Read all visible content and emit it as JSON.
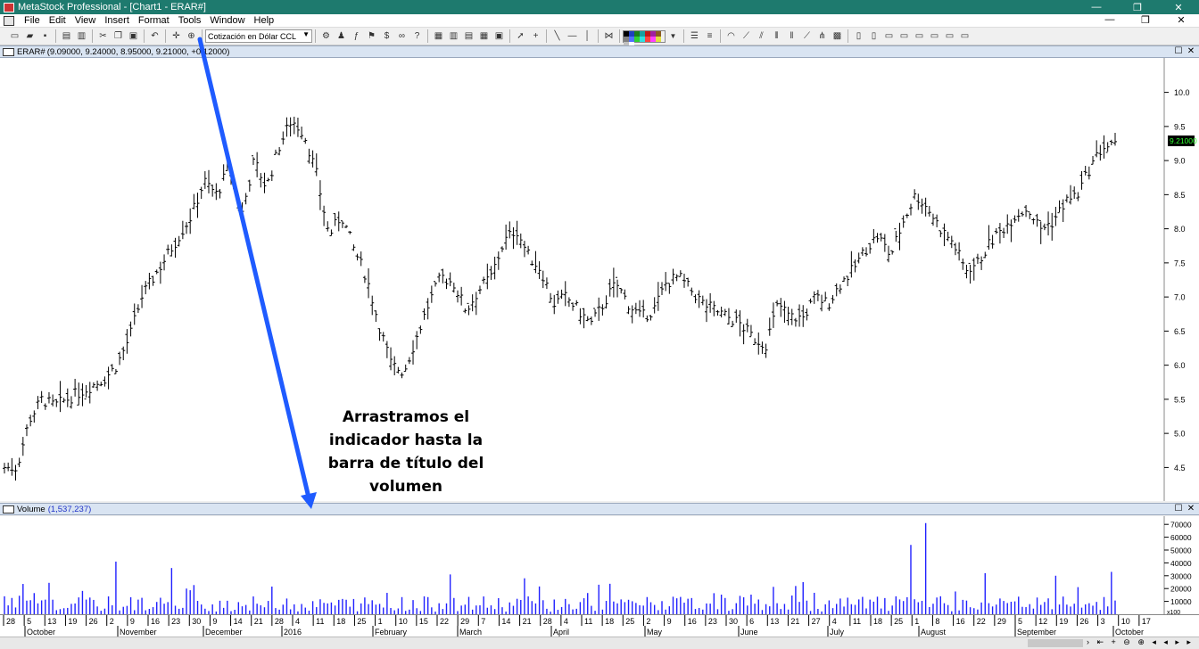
{
  "window": {
    "title": "MetaStock Professional - [Chart1 - ERAR#]",
    "buttons": {
      "minimize": "—",
      "restore": "❐",
      "close": "✕"
    }
  },
  "menu": [
    "File",
    "Edit",
    "View",
    "Insert",
    "Format",
    "Tools",
    "Window",
    "Help"
  ],
  "mdi_buttons": {
    "minimize": "—",
    "restore": "❐",
    "close": "✕"
  },
  "toolbar": {
    "indicator_combo": "Cotización en Dólar CCL",
    "palette": [
      "#000000",
      "#1f3fbf",
      "#1b7f1b",
      "#18a0a0",
      "#c01818",
      "#a020a0",
      "#8a5a20",
      "#808080",
      "#5070ff",
      "#30d030",
      "#30e0e0",
      "#ff4040",
      "#ff40ff",
      "#e0e040",
      "#c0c0c0",
      "#ffffff"
    ]
  },
  "price_pane": {
    "title": "ERAR#",
    "info": "(9.09000, 9.24000, 8.95000, 9.21000, +0.12000)",
    "last_value": "9.21000"
  },
  "volume_pane": {
    "title": "Volume",
    "info": "(1,537,237)",
    "scale_note": "x100"
  },
  "annotation": {
    "lines": [
      "Arrastramos el",
      "indicador hasta la",
      "barra de título del",
      "volumen"
    ],
    "arrow_color": "#1f5bff"
  },
  "chart_data": {
    "type": "bar",
    "price_axis": {
      "ylim": [
        4.1,
        10.4
      ],
      "ticks": [
        "4.5",
        "5.0",
        "5.5",
        "6.0",
        "6.5",
        "7.0",
        "7.5",
        "8.0",
        "8.5",
        "9.0",
        "9.5",
        "10.0"
      ]
    },
    "volume_axis": {
      "ylim": [
        0,
        75000
      ],
      "ticks": [
        "10000",
        "20000",
        "30000",
        "40000",
        "50000",
        "60000",
        "70000"
      ]
    },
    "x_day_labels": [
      "28",
      "5",
      "13",
      "19",
      "26",
      "2",
      "9",
      "16",
      "23",
      "30",
      "9",
      "14",
      "21",
      "28",
      "4",
      "11",
      "18",
      "25",
      "1",
      "10",
      "15",
      "22",
      "29",
      "7",
      "14",
      "21",
      "28",
      "4",
      "11",
      "18",
      "25",
      "2",
      "9",
      "16",
      "23",
      "30",
      "6",
      "13",
      "21",
      "27",
      "4",
      "11",
      "18",
      "25",
      "1",
      "8",
      "16",
      "22",
      "29",
      "5",
      "12",
      "19",
      "26",
      "3",
      "10",
      "17"
    ],
    "x_month_labels": [
      "October",
      "November",
      "December",
      "2016",
      "February",
      "March",
      "April",
      "May",
      "June",
      "July",
      "August",
      "September",
      "October"
    ],
    "close_path": [
      [
        4.5,
        4.5
      ],
      [
        5.2,
        5.5
      ],
      [
        5.4,
        5.5
      ],
      [
        5.6,
        5.7
      ],
      [
        5.8,
        6.0
      ],
      [
        6.4,
        7.0
      ],
      [
        7.3,
        7.6
      ],
      [
        7.9,
        8.2
      ],
      [
        8.7,
        8.5
      ],
      [
        8.9,
        8.2
      ],
      [
        9.0,
        8.6
      ],
      [
        9.2,
        9.6
      ],
      [
        9.4,
        8.8
      ],
      [
        7.9,
        8.2
      ],
      [
        7.7,
        7.3
      ],
      [
        6.6,
        6.0
      ],
      [
        5.9,
        6.4
      ],
      [
        6.9,
        7.3
      ],
      [
        7.2,
        6.8
      ],
      [
        7.1,
        7.3
      ],
      [
        7.8,
        8.0
      ],
      [
        7.6,
        7.4
      ],
      [
        6.9,
        7.0
      ],
      [
        6.8,
        6.6
      ],
      [
        6.9,
        7.2
      ],
      [
        6.9,
        6.7
      ],
      [
        6.8,
        7.2
      ],
      [
        7.3,
        7.1
      ],
      [
        6.9,
        6.8
      ],
      [
        6.7,
        6.6
      ],
      [
        6.4,
        6.3
      ],
      [
        6.9,
        6.7
      ],
      [
        6.7,
        7.0
      ],
      [
        6.9,
        7.2
      ],
      [
        7.4,
        7.7
      ],
      [
        7.9,
        7.6
      ],
      [
        8.1,
        8.5
      ],
      [
        8.3,
        8.0
      ],
      [
        7.8,
        7.4
      ],
      [
        7.5,
        7.8
      ],
      [
        8.0,
        8.2
      ],
      [
        8.3,
        8.0
      ],
      [
        8.1,
        8.4
      ],
      [
        8.5,
        8.9
      ],
      [
        9.2,
        9.21
      ]
    ],
    "volume_spikes": [
      [
        "9",
        41000
      ],
      [
        "16",
        36000
      ],
      [
        "2016",
        8000
      ],
      [
        "22",
        31000
      ],
      [
        "27",
        25000
      ],
      [
        "18",
        71000
      ],
      [
        "25",
        32000
      ],
      [
        "29",
        30000
      ],
      [
        "26",
        33000
      ]
    ]
  }
}
